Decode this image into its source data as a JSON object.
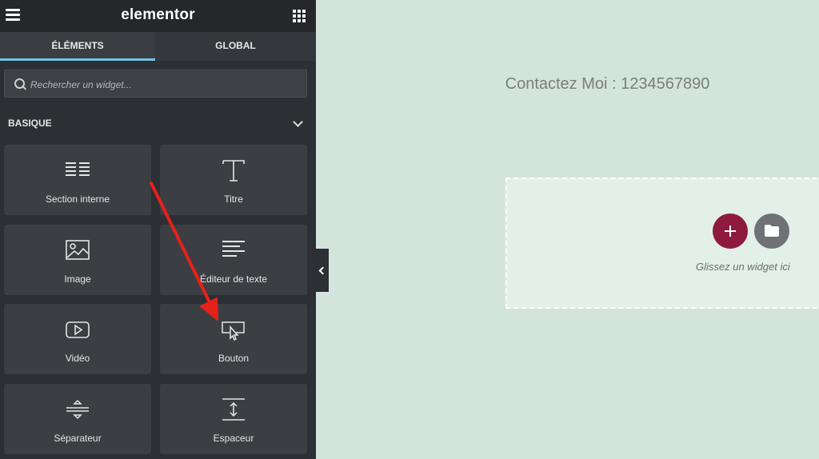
{
  "header": {
    "logo_text": "elementor"
  },
  "tabs": [
    {
      "label": "ÉLÉMENTS",
      "active": true
    },
    {
      "label": "GLOBAL",
      "active": false
    }
  ],
  "search": {
    "placeholder": "Rechercher un widget..."
  },
  "category": {
    "label": "BASIQUE"
  },
  "widgets": [
    {
      "label": "Section interne",
      "icon": "columns-icon"
    },
    {
      "label": "Titre",
      "icon": "heading-icon"
    },
    {
      "label": "Image",
      "icon": "image-icon"
    },
    {
      "label": "Éditeur de texte",
      "icon": "text-editor-icon"
    },
    {
      "label": "Vidéo",
      "icon": "video-icon"
    },
    {
      "label": "Bouton",
      "icon": "button-icon"
    },
    {
      "label": "Séparateur",
      "icon": "divider-icon"
    },
    {
      "label": "Espaceur",
      "icon": "spacer-icon"
    }
  ],
  "canvas": {
    "contact_text": "Contactez Moi : 1234567890",
    "drop_hint": "Glissez un widget ici"
  },
  "colors": {
    "panel_bg": "#2c2f33",
    "tab_accent": "#71c3e6",
    "add_button": "#8e1a3f",
    "canvas_bg": "#d3e4dc",
    "arrow": "#e8201a"
  }
}
